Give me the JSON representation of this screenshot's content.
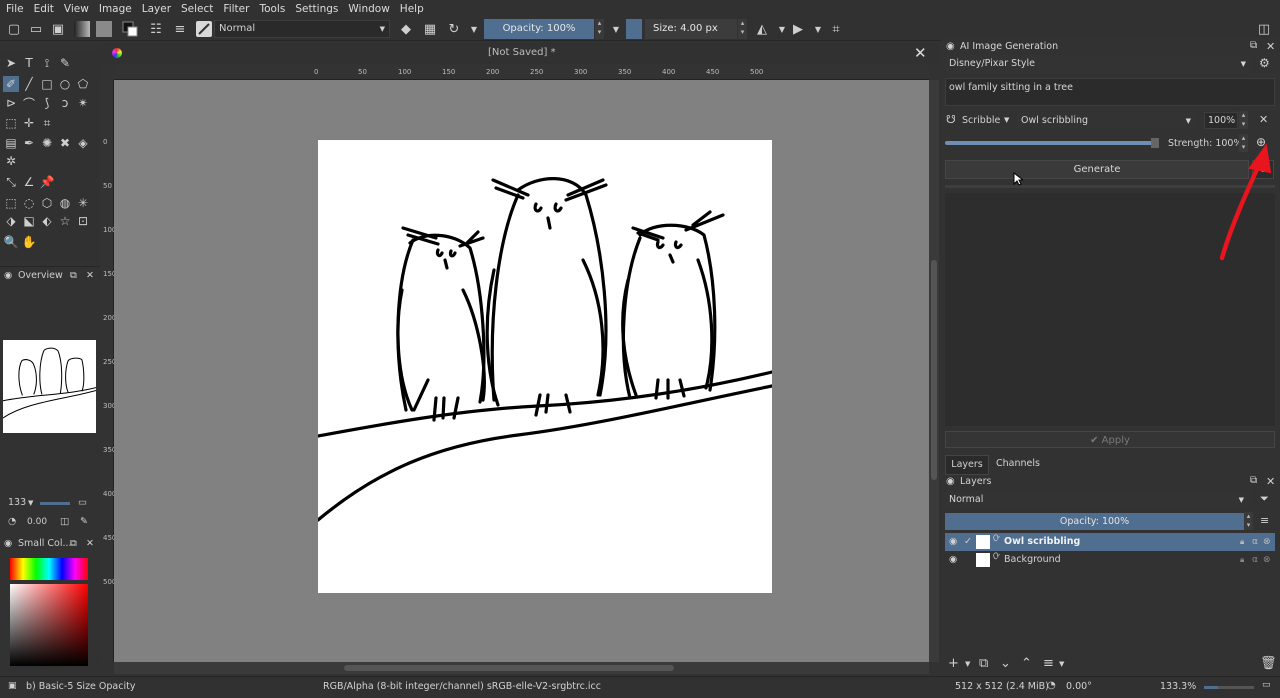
{
  "menubar": {
    "items": [
      "File",
      "Edit",
      "View",
      "Image",
      "Layer",
      "Select",
      "Filter",
      "Tools",
      "Settings",
      "Window",
      "Help"
    ]
  },
  "toolbar": {
    "blend_mode": "Normal",
    "opacity": "Opacity: 100%",
    "size": "Size: 4.00 px"
  },
  "document": {
    "title": "[Not Saved]  *",
    "ruler_labels": [
      "0",
      "50",
      "100",
      "150",
      "200",
      "250",
      "300",
      "350",
      "400",
      "450",
      "500"
    ],
    "vruler_labels": [
      "0",
      "50",
      "100",
      "150",
      "200",
      "250",
      "300",
      "350",
      "400",
      "450",
      "500"
    ]
  },
  "left_panels": {
    "overview_title": "Overview",
    "zoom_value": "133",
    "rotation_value": "0.00",
    "small_color_title": "Small Col..."
  },
  "ai_panel": {
    "title": "AI Image Generation",
    "style": "Disney/Pixar Style",
    "prompt": "owl family sitting in a tree",
    "control_type": "Scribble",
    "control_layer": "Owl scribbling",
    "control_percent": "100%",
    "strength": "Strength: 100%",
    "strength_fraction": 1.0,
    "generate_label": "Generate",
    "count_badge": "0",
    "apply_label": "Apply"
  },
  "layers_panel": {
    "tabs": [
      "Layers",
      "Channels"
    ],
    "title": "Layers",
    "blend_mode": "Normal",
    "opacity": "Opacity:  100%",
    "layers": [
      {
        "name": "Owl scribbling",
        "selected": true
      },
      {
        "name": "Background",
        "selected": false
      }
    ]
  },
  "statusbar": {
    "brush": "b) Basic-5 Size Opacity",
    "color_info": "RGB/Alpha (8-bit integer/channel)  sRGB-elle-V2-srgbtrc.icc",
    "dimensions": "512 x 512 (2.4 MiB)",
    "rotation": "0.00°",
    "zoom": "133.3%"
  },
  "colors": {
    "accent": "#4f6e90",
    "background": "#323232",
    "canvas": "#818181",
    "arrow": "#e8141e"
  }
}
